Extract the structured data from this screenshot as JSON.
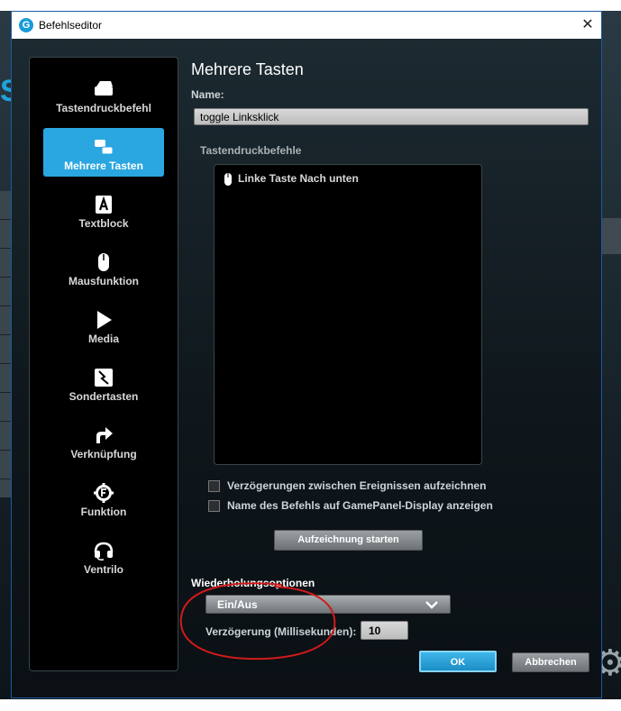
{
  "window": {
    "title": "Befehlseditor",
    "close_glyph": "✕",
    "logo_glyph": "G"
  },
  "sidebar": {
    "items": [
      {
        "label": "Tastendruckbefehl",
        "icon": "key-icon",
        "active": false
      },
      {
        "label": "Mehrere Tasten",
        "icon": "multi-key-icon",
        "active": true
      },
      {
        "label": "Textblock",
        "icon": "text-block-icon",
        "active": false
      },
      {
        "label": "Mausfunktion",
        "icon": "mouse-icon",
        "active": false
      },
      {
        "label": "Media",
        "icon": "play-icon",
        "active": false
      },
      {
        "label": "Sondertasten",
        "icon": "special-key-icon",
        "active": false
      },
      {
        "label": "Verknüpfung",
        "icon": "shortcut-arrow-icon",
        "active": false
      },
      {
        "label": "Funktion",
        "icon": "function-gear-icon",
        "active": false
      },
      {
        "label": "Ventrilo",
        "icon": "headset-icon",
        "active": false
      }
    ]
  },
  "main": {
    "title": "Mehrere Tasten",
    "name_label": "Name:",
    "name_value": "toggle Linksklick",
    "keys_label": "Tastendruckbefehle",
    "keys": [
      {
        "label": "Linke Taste Nach unten",
        "icon": "mouse-icon"
      }
    ],
    "checkboxes": [
      {
        "label": "Verzögerungen zwischen Ereignissen aufzeichnen",
        "checked": false
      },
      {
        "label": "Name des Befehls auf GamePanel-Display anzeigen",
        "checked": false
      }
    ],
    "record_button": "Aufzeichnung starten",
    "repeat_label": "Wiederholungsoptionen",
    "repeat_value": "Ein/Aus",
    "delay_label": "Verzögerung (Millisekunden):",
    "delay_value": "10",
    "ok_button": "OK",
    "cancel_button": "Abbrechen"
  },
  "colors": {
    "accent": "#2aa6e0",
    "annotation": "#d11a1a"
  }
}
